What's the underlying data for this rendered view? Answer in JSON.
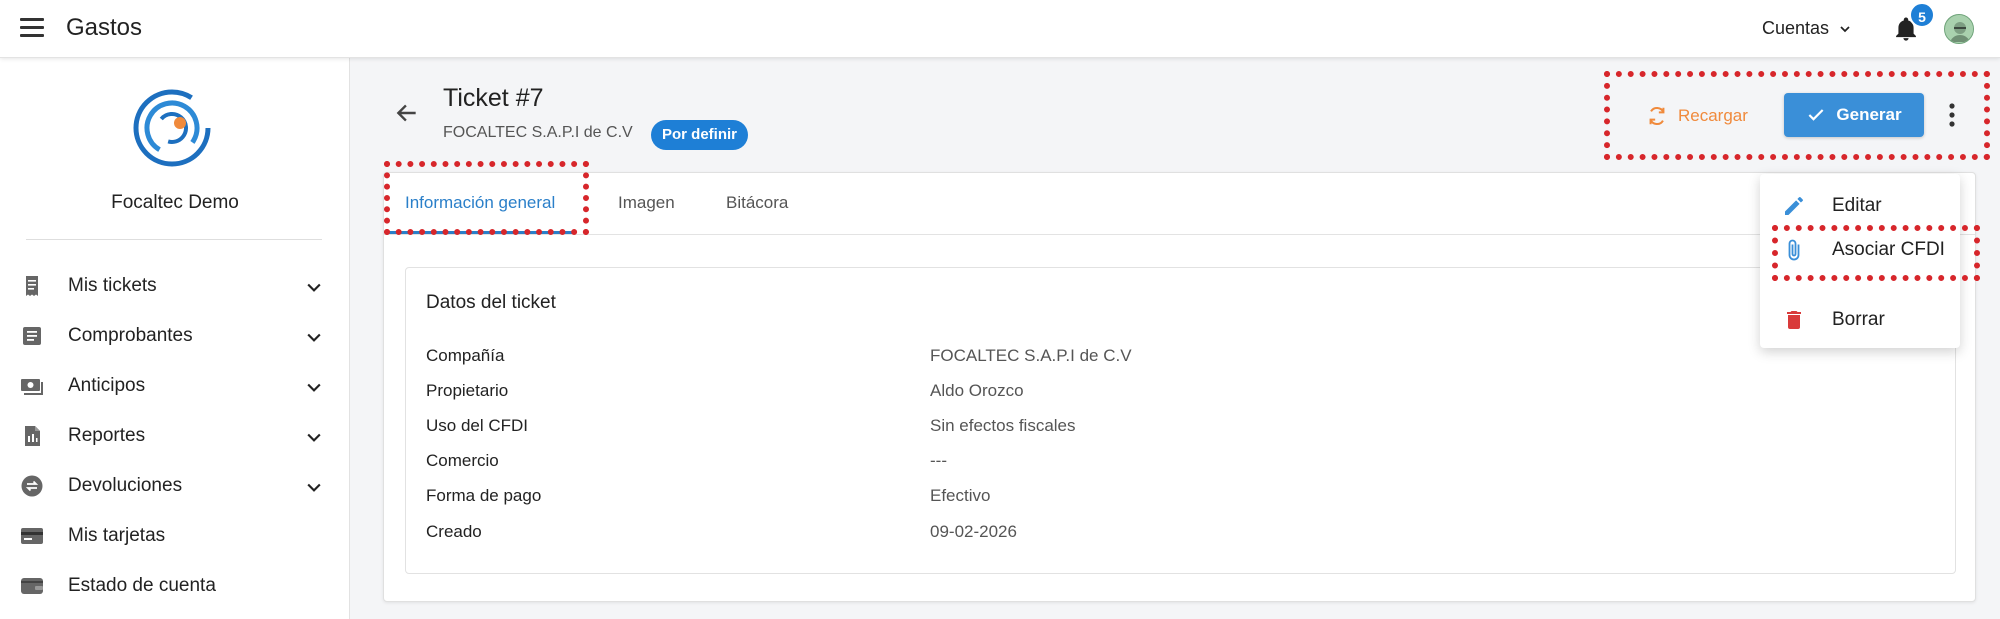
{
  "app": {
    "title": "Gastos"
  },
  "header": {
    "accounts_label": "Cuentas",
    "notification_count": "5"
  },
  "sidebar": {
    "org_name": "Focaltec Demo",
    "items": [
      {
        "label": "Mis tickets",
        "icon": "receipt-icon",
        "expandable": true
      },
      {
        "label": "Comprobantes",
        "icon": "document-icon",
        "expandable": true
      },
      {
        "label": "Anticipos",
        "icon": "cash-icon",
        "expandable": true
      },
      {
        "label": "Reportes",
        "icon": "report-icon",
        "expandable": true
      },
      {
        "label": "Devoluciones",
        "icon": "refund-icon",
        "expandable": true
      },
      {
        "label": "Mis tarjetas",
        "icon": "credit-card-icon",
        "expandable": false
      },
      {
        "label": "Estado de cuenta",
        "icon": "wallet-icon",
        "expandable": false
      }
    ]
  },
  "ticket": {
    "title": "Ticket #7",
    "company": "FOCALTEC S.A.P.I de C.V",
    "status": "Por definir"
  },
  "actions": {
    "reload_label": "Recargar",
    "generate_label": "Generar"
  },
  "tabs": [
    {
      "label": "Información general",
      "active": true
    },
    {
      "label": "Imagen",
      "active": false
    },
    {
      "label": "Bitácora",
      "active": false
    }
  ],
  "details": {
    "section_title": "Datos del ticket",
    "fields": [
      {
        "label": "Compañía",
        "value": "FOCALTEC S.A.P.I de C.V"
      },
      {
        "label": "Propietario",
        "value": "Aldo Orozco"
      },
      {
        "label": "Uso del CFDI",
        "value": "Sin efectos fiscales"
      },
      {
        "label": "Comercio",
        "value": "---"
      },
      {
        "label": "Forma de pago",
        "value": "Efectivo"
      },
      {
        "label": "Creado",
        "value": "09-02-2026"
      }
    ]
  },
  "menu": {
    "items": [
      {
        "label": "Editar",
        "icon": "pencil-icon"
      },
      {
        "label": "Asociar CFDI",
        "icon": "paperclip-icon"
      },
      {
        "label": "Borrar",
        "icon": "trash-icon"
      }
    ]
  },
  "colors": {
    "primary": "#1e7fd6",
    "accent_orange": "#f08a3c",
    "danger": "#d93a3a",
    "highlight": "#d7262b"
  }
}
